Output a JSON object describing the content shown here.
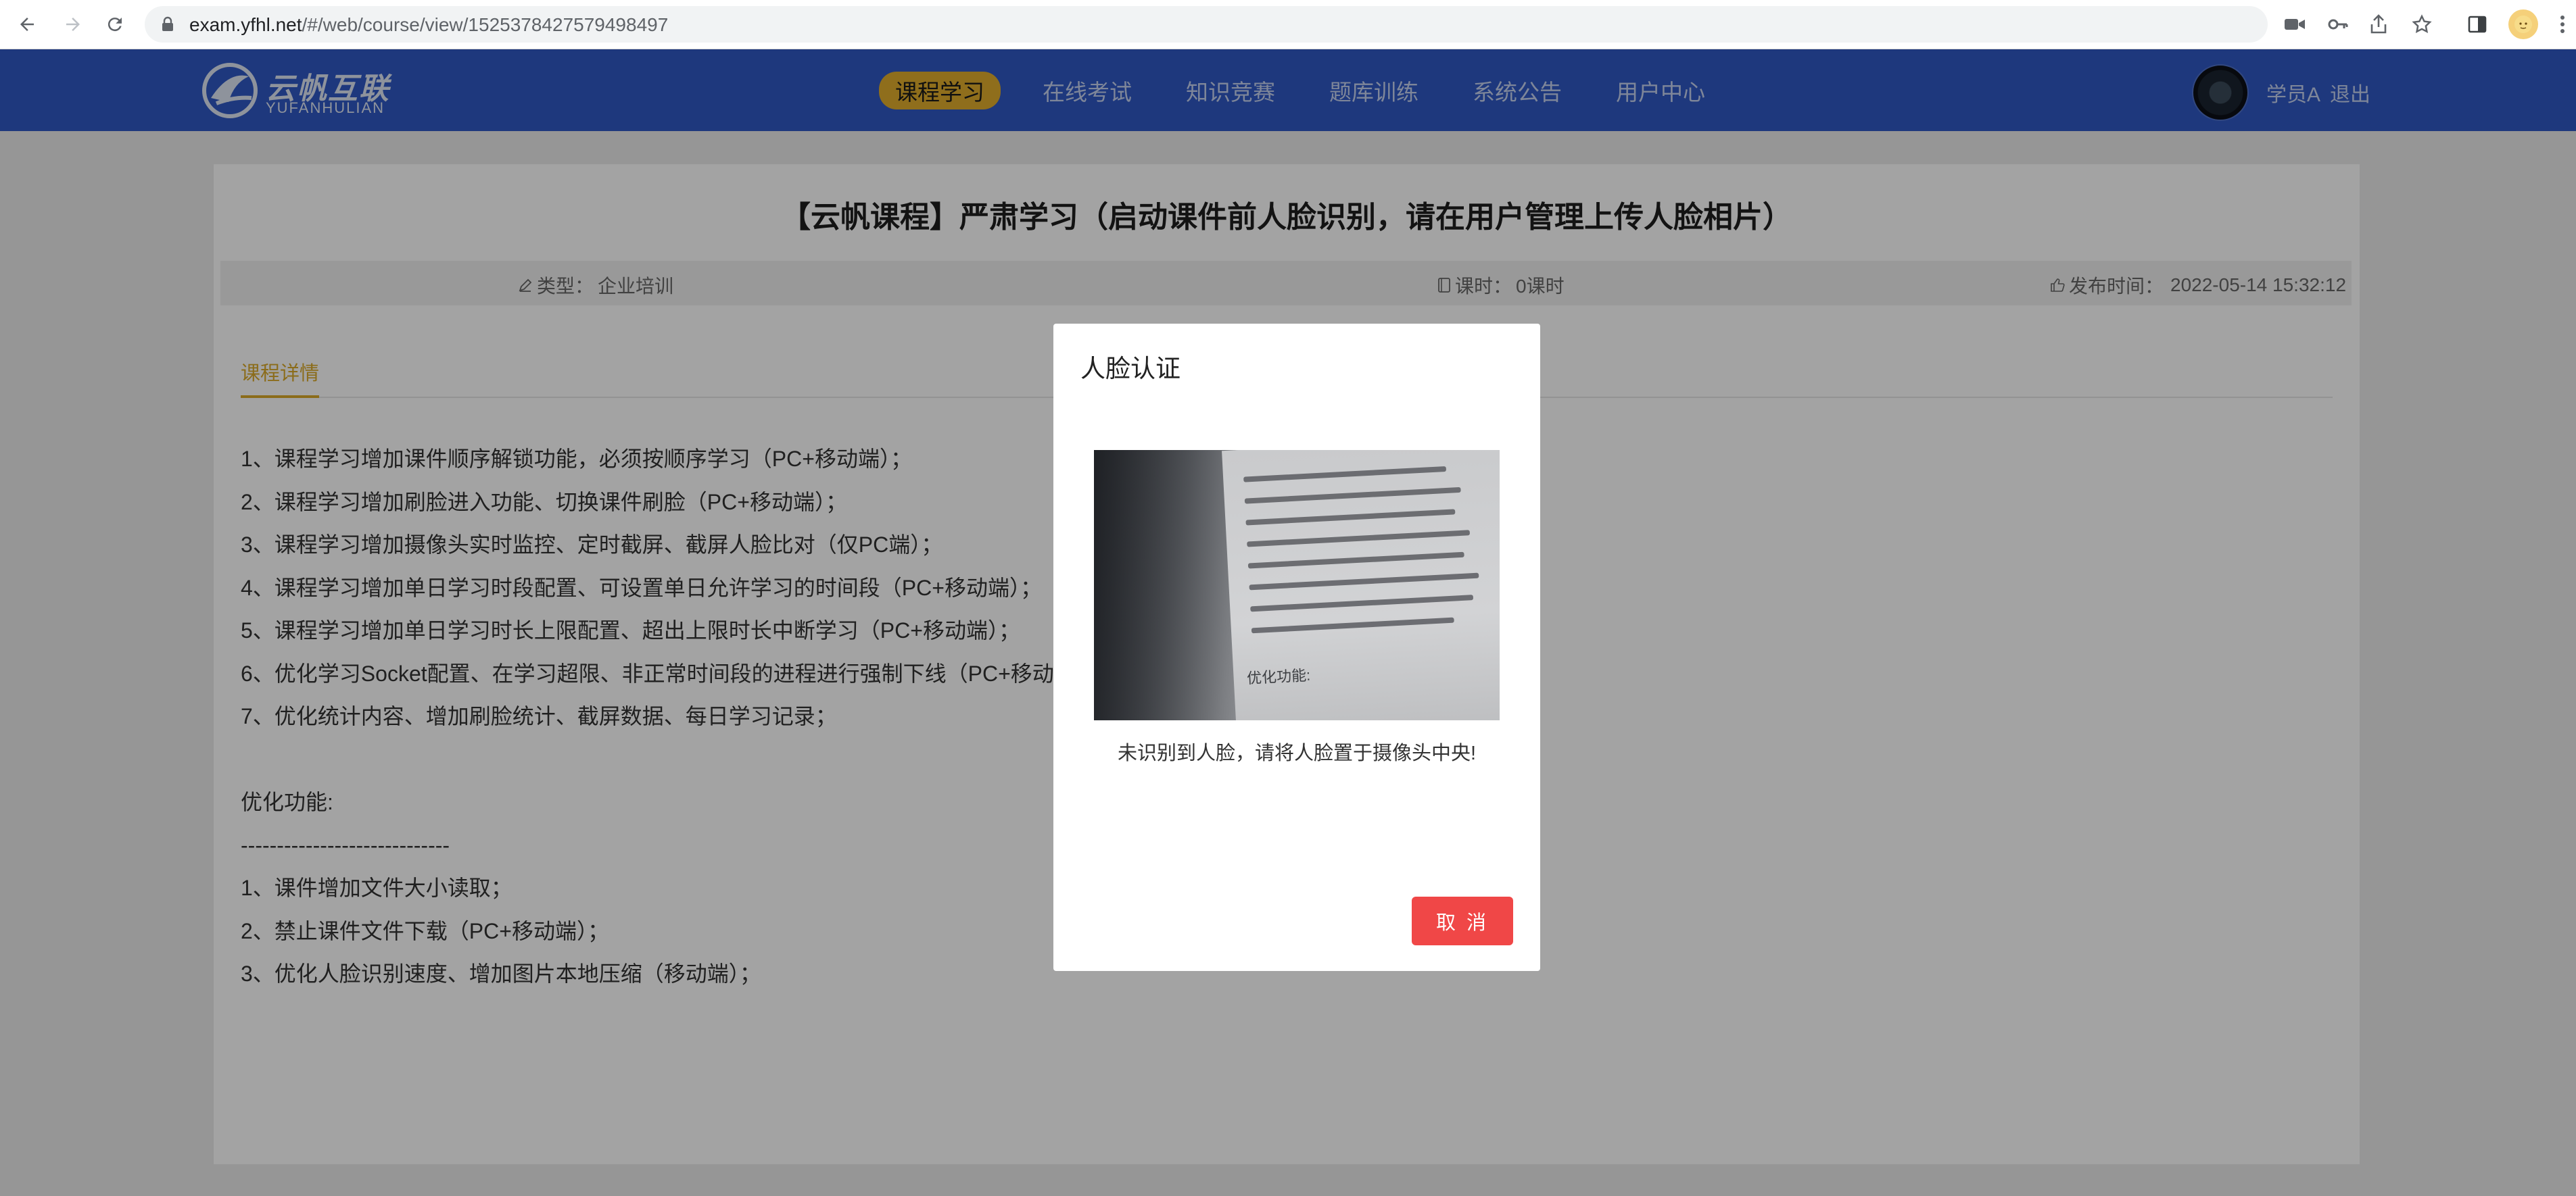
{
  "browser": {
    "url_host": "exam.yfhl.net",
    "url_path": "/#/web/course/view/1525378427579498497"
  },
  "header": {
    "logo_cn": "云帆互联",
    "logo_en": "YUFANHULIAN",
    "nav": [
      {
        "label": "课程学习",
        "active": true
      },
      {
        "label": "在线考试"
      },
      {
        "label": "知识竞赛"
      },
      {
        "label": "题库训练"
      },
      {
        "label": "系统公告"
      },
      {
        "label": "用户中心"
      }
    ],
    "user_name": "学员A",
    "logout_label": "退出"
  },
  "course": {
    "title": "【云帆课程】严肃学习（启动课件前人脸识别，请在用户管理上传人脸相片）",
    "type_label": "类型：",
    "type_value": "企业培训",
    "hours_label": "课时：",
    "hours_value": "0课时",
    "publish_label": "发布时间：",
    "publish_value": "2022-05-14 15:32:12",
    "tab_details": "课程详情",
    "description": [
      "1、课程学习增加课件顺序解锁功能，必须按顺序学习（PC+移动端）；",
      "2、课程学习增加刷脸进入功能、切换课件刷脸（PC+移动端）；",
      "3、课程学习增加摄像头实时监控、定时截屏、截屏人脸比对（仅PC端）；",
      "4、课程学习增加单日学习时段配置、可设置单日允许学习的时间段（PC+移动端）；",
      "5、课程学习增加单日学习时长上限配置、超出上限时长中断学习（PC+移动端）；",
      "6、优化学习Socket配置、在学习超限、非正常时间段的进程进行强制下线（PC+移动",
      "7、优化统计内容、增加刷脸统计、截屏数据、每日学习记录；",
      "",
      "优化功能:",
      "-----------------------------",
      "1、课件增加文件大小读取；",
      "2、禁止课件文件下载（PC+移动端）；",
      "3、优化人脸识别速度、增加图片本地压缩（移动端）；"
    ]
  },
  "modal": {
    "title": "人脸认证",
    "camera_overlay_text": "优化功能:",
    "message": "未识别到人脸，请将人脸置于摄像头中央!",
    "cancel_label": "取 消"
  },
  "colors": {
    "header_bg": "#2f58c4",
    "nav_active_bg": "#e0ad2c",
    "tab_active": "#d9a92a",
    "cancel_button": "#f04747"
  }
}
